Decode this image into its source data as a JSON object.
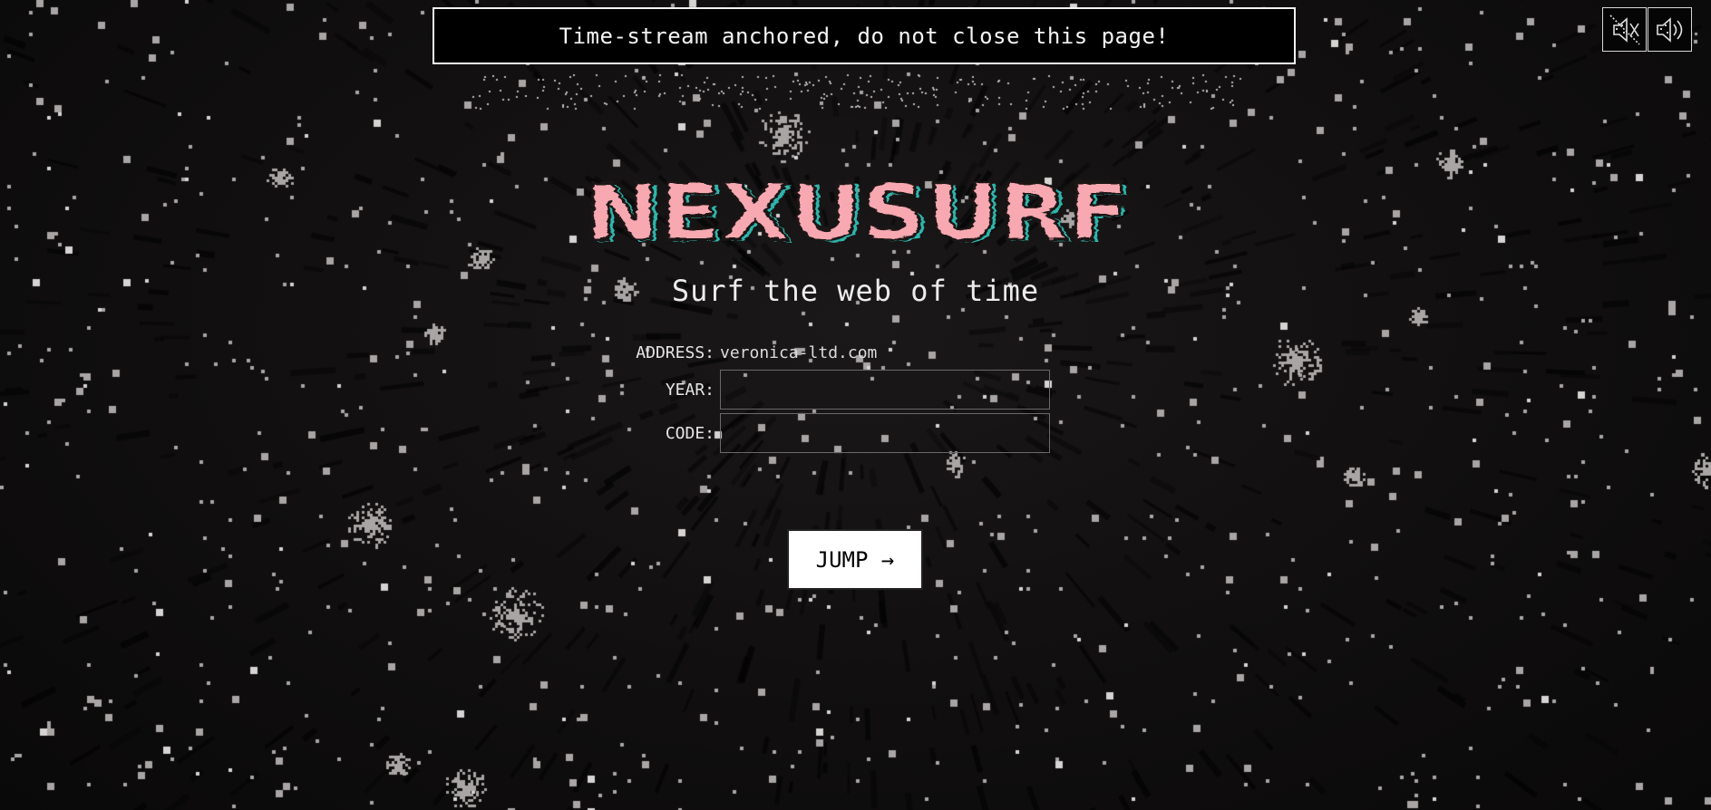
{
  "banner": {
    "text": "Time-stream anchored, do not close this page!"
  },
  "corner_buttons": [
    {
      "icon": "sound-off-icon"
    },
    {
      "icon": "sound-on-icon"
    }
  ],
  "logo": {
    "text": "NEXUSURF",
    "fill_color": "#f7a8b0",
    "shadow_color": "#2fb6ad",
    "outline_color": "#1a1414"
  },
  "tagline": "Surf the web of time",
  "form": {
    "address_label": "ADDRESS:",
    "address_value": "veronica-ltd.com",
    "year_label": "YEAR:",
    "year_value": "",
    "code_label": "CODE:",
    "code_value": ""
  },
  "jump_button": {
    "label": "JUMP →"
  },
  "colors": {
    "background": "#0d0c0c",
    "star": "#a9a5a5",
    "text": "#ececec"
  }
}
